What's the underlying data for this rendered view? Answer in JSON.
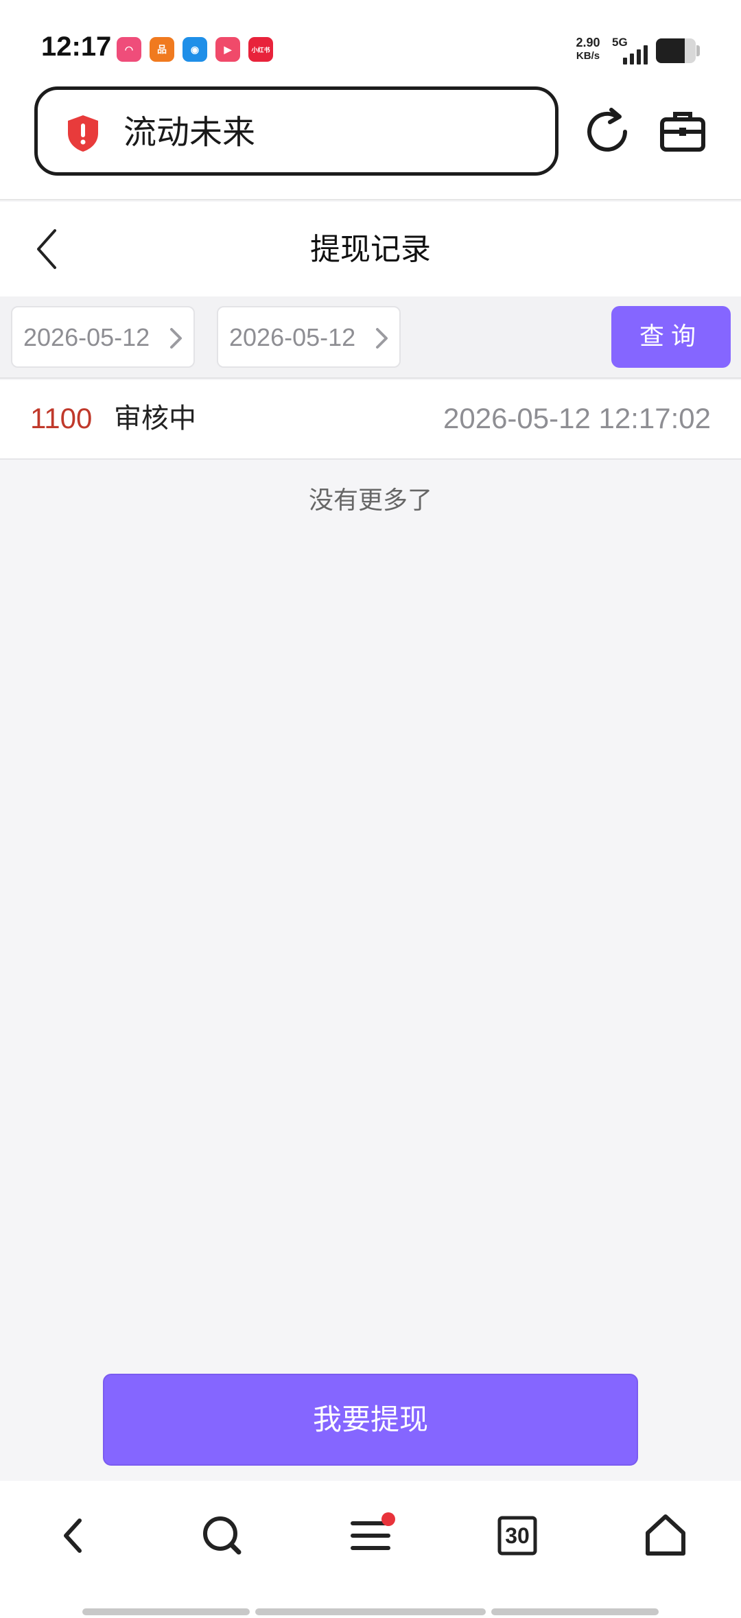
{
  "status_bar": {
    "time": "12:17",
    "net_speed_value": "2.90",
    "net_speed_unit": "KB/s",
    "network_type": "5G",
    "app_icons": [
      {
        "name": "app-icon-1",
        "color": "#ef4d7a",
        "glyph": "◠"
      },
      {
        "name": "app-icon-2",
        "color": "#f07a1f",
        "glyph": "品"
      },
      {
        "name": "app-icon-3",
        "color": "#1f8fe8",
        "glyph": "◉"
      },
      {
        "name": "app-icon-4",
        "color": "#f04a6a",
        "glyph": "▶"
      },
      {
        "name": "app-icon-5",
        "color": "#e8233b",
        "glyph": "小红书"
      }
    ]
  },
  "address_bar": {
    "text": "流动未来",
    "security_icon": "shield-alert-icon",
    "security_color": "#e83b3b"
  },
  "header": {
    "title": "提现记录"
  },
  "filter": {
    "start_date": "2026-05-12",
    "end_date": "2026-05-12",
    "query_label": "查询"
  },
  "records": [
    {
      "amount": "1100",
      "status": "审核中",
      "time": "2026-05-12 12:17:02"
    }
  ],
  "list_end_text": "没有更多了",
  "withdraw_label": "我要提现",
  "bottom_nav": {
    "tab_count": "30",
    "items": [
      "back-icon",
      "search-icon",
      "menu-icon",
      "tabs-icon",
      "home-icon"
    ]
  },
  "colors": {
    "accent": "#8566ff",
    "amount": "#c0392b"
  }
}
